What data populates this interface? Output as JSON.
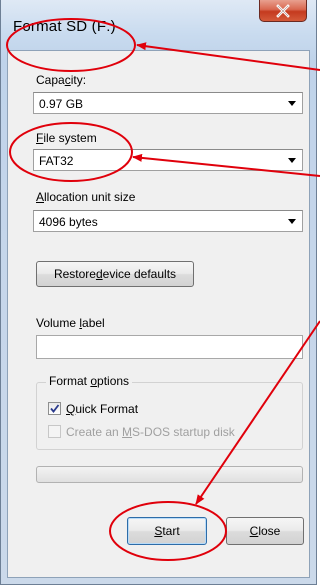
{
  "window": {
    "title": "Format SD (F:)",
    "close_icon": "close-x-icon"
  },
  "capacity": {
    "label_pre": "Capa",
    "label_key": "c",
    "label_post": "ity:",
    "value": "0.97 GB"
  },
  "file_system": {
    "label_key": "F",
    "label_post": "ile system",
    "value": "FAT32"
  },
  "allocation": {
    "label_key": "A",
    "label_post": "llocation unit size",
    "value": "4096 bytes"
  },
  "restore_button": {
    "pre": "Restore ",
    "key": "d",
    "post": "evice defaults"
  },
  "volume_label": {
    "pre": "Volume ",
    "key": "l",
    "post": "abel",
    "value": ""
  },
  "format_options": {
    "title_pre": "Format ",
    "title_key": "o",
    "title_post": "ptions",
    "quick_format": {
      "key": "Q",
      "post": "uick Format",
      "checked": true,
      "enabled": true
    },
    "msdos_disk": {
      "pre": "Create an ",
      "key": "M",
      "post": "S-DOS startup disk",
      "checked": false,
      "enabled": false
    }
  },
  "progress": {
    "value_percent": 0
  },
  "start_button": {
    "key": "S",
    "post": "tart"
  },
  "close_button": {
    "key": "C",
    "post": "lose"
  },
  "annotations": {
    "color": "#e0000b"
  }
}
